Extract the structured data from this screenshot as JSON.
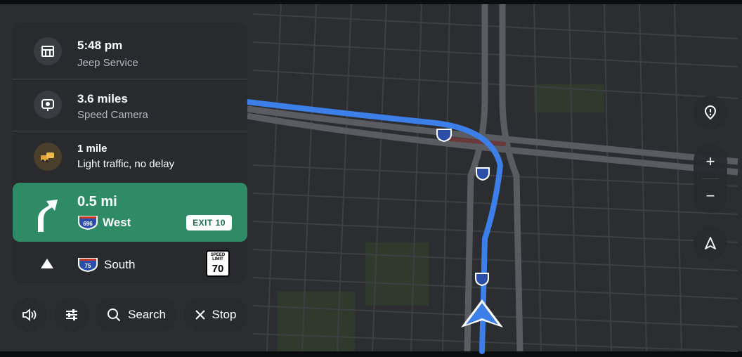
{
  "panel": {
    "items": [
      {
        "primary": "5:48 pm",
        "secondary": "Jeep Service",
        "icon": "fuel-station-icon"
      },
      {
        "primary": "3.6 miles",
        "secondary": "Speed Camera",
        "icon": "speed-camera-icon"
      },
      {
        "primary": "1 mile",
        "secondary": "Light traffic, no delay",
        "icon": "traffic-cars-icon"
      }
    ],
    "active": {
      "distance": "0.5 mi",
      "shield": "696",
      "direction": "West",
      "exit": "EXIT 10",
      "icon": "slight-right-arrow-icon"
    },
    "next": {
      "shield": "75",
      "direction": "South",
      "speed_limit_label": "SPEED LIMIT",
      "speed_limit_value": "70",
      "icon": "straight-arrow-icon"
    }
  },
  "controls": {
    "search_label": "Search",
    "stop_label": "Stop",
    "sound_icon": "volume-icon",
    "settings_icon": "sliders-icon",
    "search_icon": "search-icon",
    "stop_icon": "close-icon"
  },
  "map_controls": {
    "report_icon": "report-incident-icon",
    "zoom_in": "+",
    "zoom_out": "−",
    "compass_icon": "north-arrow-icon"
  },
  "colors": {
    "route": "#3d7fe8",
    "panel": "#282a2e",
    "active": "#2e8b66",
    "map_bg": "#2a2b2e"
  }
}
